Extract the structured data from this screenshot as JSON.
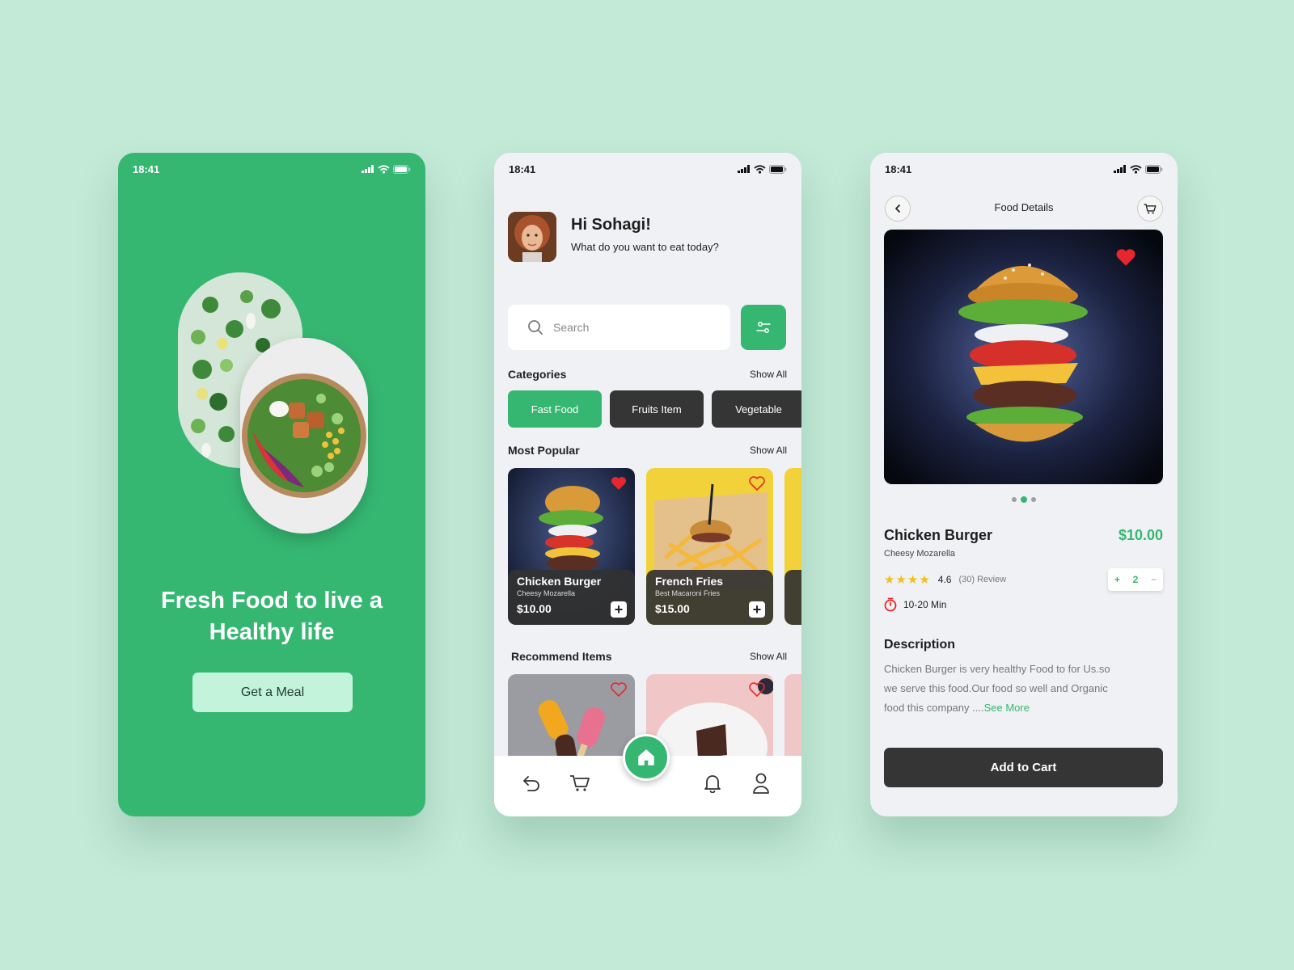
{
  "colors": {
    "background": "#c3e9d7",
    "accent": "#35b772",
    "dark": "#353535",
    "heart": "#e8262d",
    "star": "#f4bf1a"
  },
  "status_time": "18:41",
  "screen1": {
    "headline": "Fresh Food to live a Healthy life",
    "cta": "Get a Meal"
  },
  "screen2": {
    "greeting": "Hi Sohagi!",
    "subgreeting": "What do you want to eat today?",
    "search_placeholder": "Search",
    "categories_title": "Categories",
    "show_all": "Show All",
    "categories": [
      "Fast Food",
      "Fruits Item",
      "Vegetable"
    ],
    "popular_title": "Most Popular",
    "popular": [
      {
        "name": "Chicken Burger",
        "sub": "Cheesy Mozarella",
        "price": "$10.00",
        "favorite": true
      },
      {
        "name": "French Fries",
        "sub": "Best Macaroni Fries",
        "price": "$15.00",
        "favorite": false
      }
    ],
    "recommend_title": "Recommend Items",
    "nav_icons": [
      "back-icon",
      "cart-icon",
      "home-icon",
      "bell-icon",
      "user-icon"
    ]
  },
  "screen3": {
    "title": "Food Details",
    "name": "Chicken Burger",
    "sub": "Cheesy Mozarella",
    "price": "$10.00",
    "rating_stars": 4,
    "rating": "4.6",
    "reviews": "(30) Review",
    "quantity": "2",
    "stepper_plus": "+",
    "stepper_minus": "−",
    "time": "10-20 Min",
    "description_title": "Description",
    "description": "Chicken Burger is very healthy Food to for Us.so we serve this food.Our food so well and Organic food this  company ....",
    "see_more": "See More",
    "add_to_cart": "Add to Cart"
  }
}
